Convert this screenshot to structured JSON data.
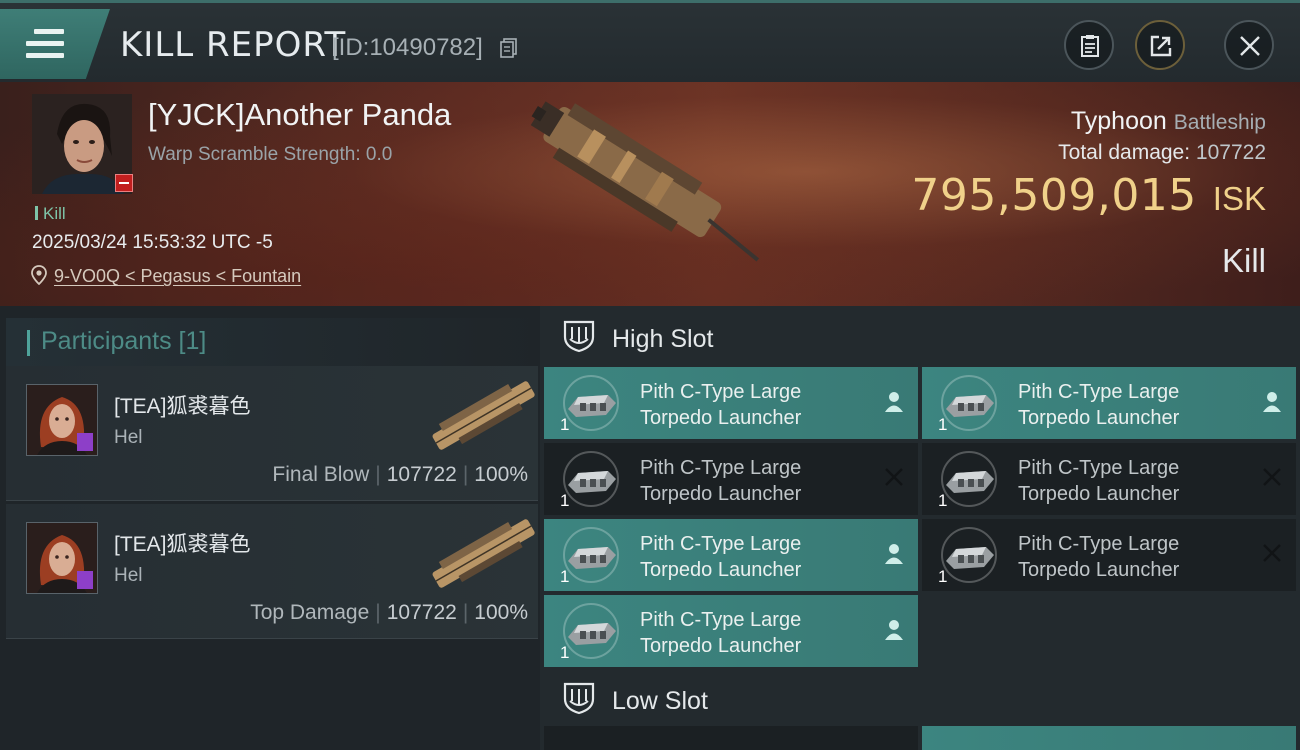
{
  "header": {
    "title": "KILL REPORT",
    "report_id": "[ID:10490782]"
  },
  "victim": {
    "name": "[YJCK]Another Panda",
    "scramble_strength": "Warp Scramble Strength: 0.0",
    "kill_tag": "Kill",
    "datetime": "2025/03/24 15:53:32 UTC -5",
    "location": "9-VO0Q < Pegasus < Fountain",
    "ship_name": "Typhoon",
    "ship_class": "Battleship",
    "total_damage_label": "Total damage:",
    "total_damage": "107722",
    "isk_value": "795,509,015",
    "isk_unit": "ISK",
    "result": "Kill"
  },
  "participants": {
    "header": "Participants [1]",
    "cards": [
      {
        "name": "[TEA]狐裘暮色",
        "ship": "Hel",
        "role": "Final Blow",
        "damage": "107722",
        "percent": "100%"
      },
      {
        "name": "[TEA]狐裘暮色",
        "ship": "Hel",
        "role": "Top Damage",
        "damage": "107722",
        "percent": "100%"
      }
    ]
  },
  "fitting": {
    "high_slot_label": "High Slot",
    "low_slot_label": "Low Slot",
    "high_modules": [
      {
        "line1": "Pith C-Type Large",
        "line2": "Torpedo Launcher",
        "qty": "1",
        "status": "fitted"
      },
      {
        "line1": "Pith C-Type Large",
        "line2": "Torpedo Launcher",
        "qty": "1",
        "status": "fitted"
      },
      {
        "line1": "Pith C-Type Large",
        "line2": "Torpedo Launcher",
        "qty": "1",
        "status": "destroyed"
      },
      {
        "line1": "Pith C-Type Large",
        "line2": "Torpedo Launcher",
        "qty": "1",
        "status": "destroyed"
      },
      {
        "line1": "Pith C-Type Large",
        "line2": "Torpedo Launcher",
        "qty": "1",
        "status": "fitted"
      },
      {
        "line1": "Pith C-Type Large",
        "line2": "Torpedo Launcher",
        "qty": "1",
        "status": "destroyed"
      },
      {
        "line1": "Pith C-Type Large",
        "line2": "Torpedo Launcher",
        "qty": "1",
        "status": "fitted"
      }
    ]
  },
  "icons": {
    "menu": "hamburger-icon",
    "copy": "copy-icon",
    "clipboard": "clipboard-icon",
    "share": "share-icon",
    "close": "close-icon",
    "location": "map-pin-icon",
    "slot": "shield-slot-icon",
    "dropped": "person-icon",
    "destroyed": "x-icon"
  },
  "colors": {
    "accent": "#3c8580",
    "isk": "#f0d18a",
    "kill_tag": "#7ec4a8",
    "loss_badge": "#c21f1f",
    "corp_badge": "#8d3fc8"
  }
}
